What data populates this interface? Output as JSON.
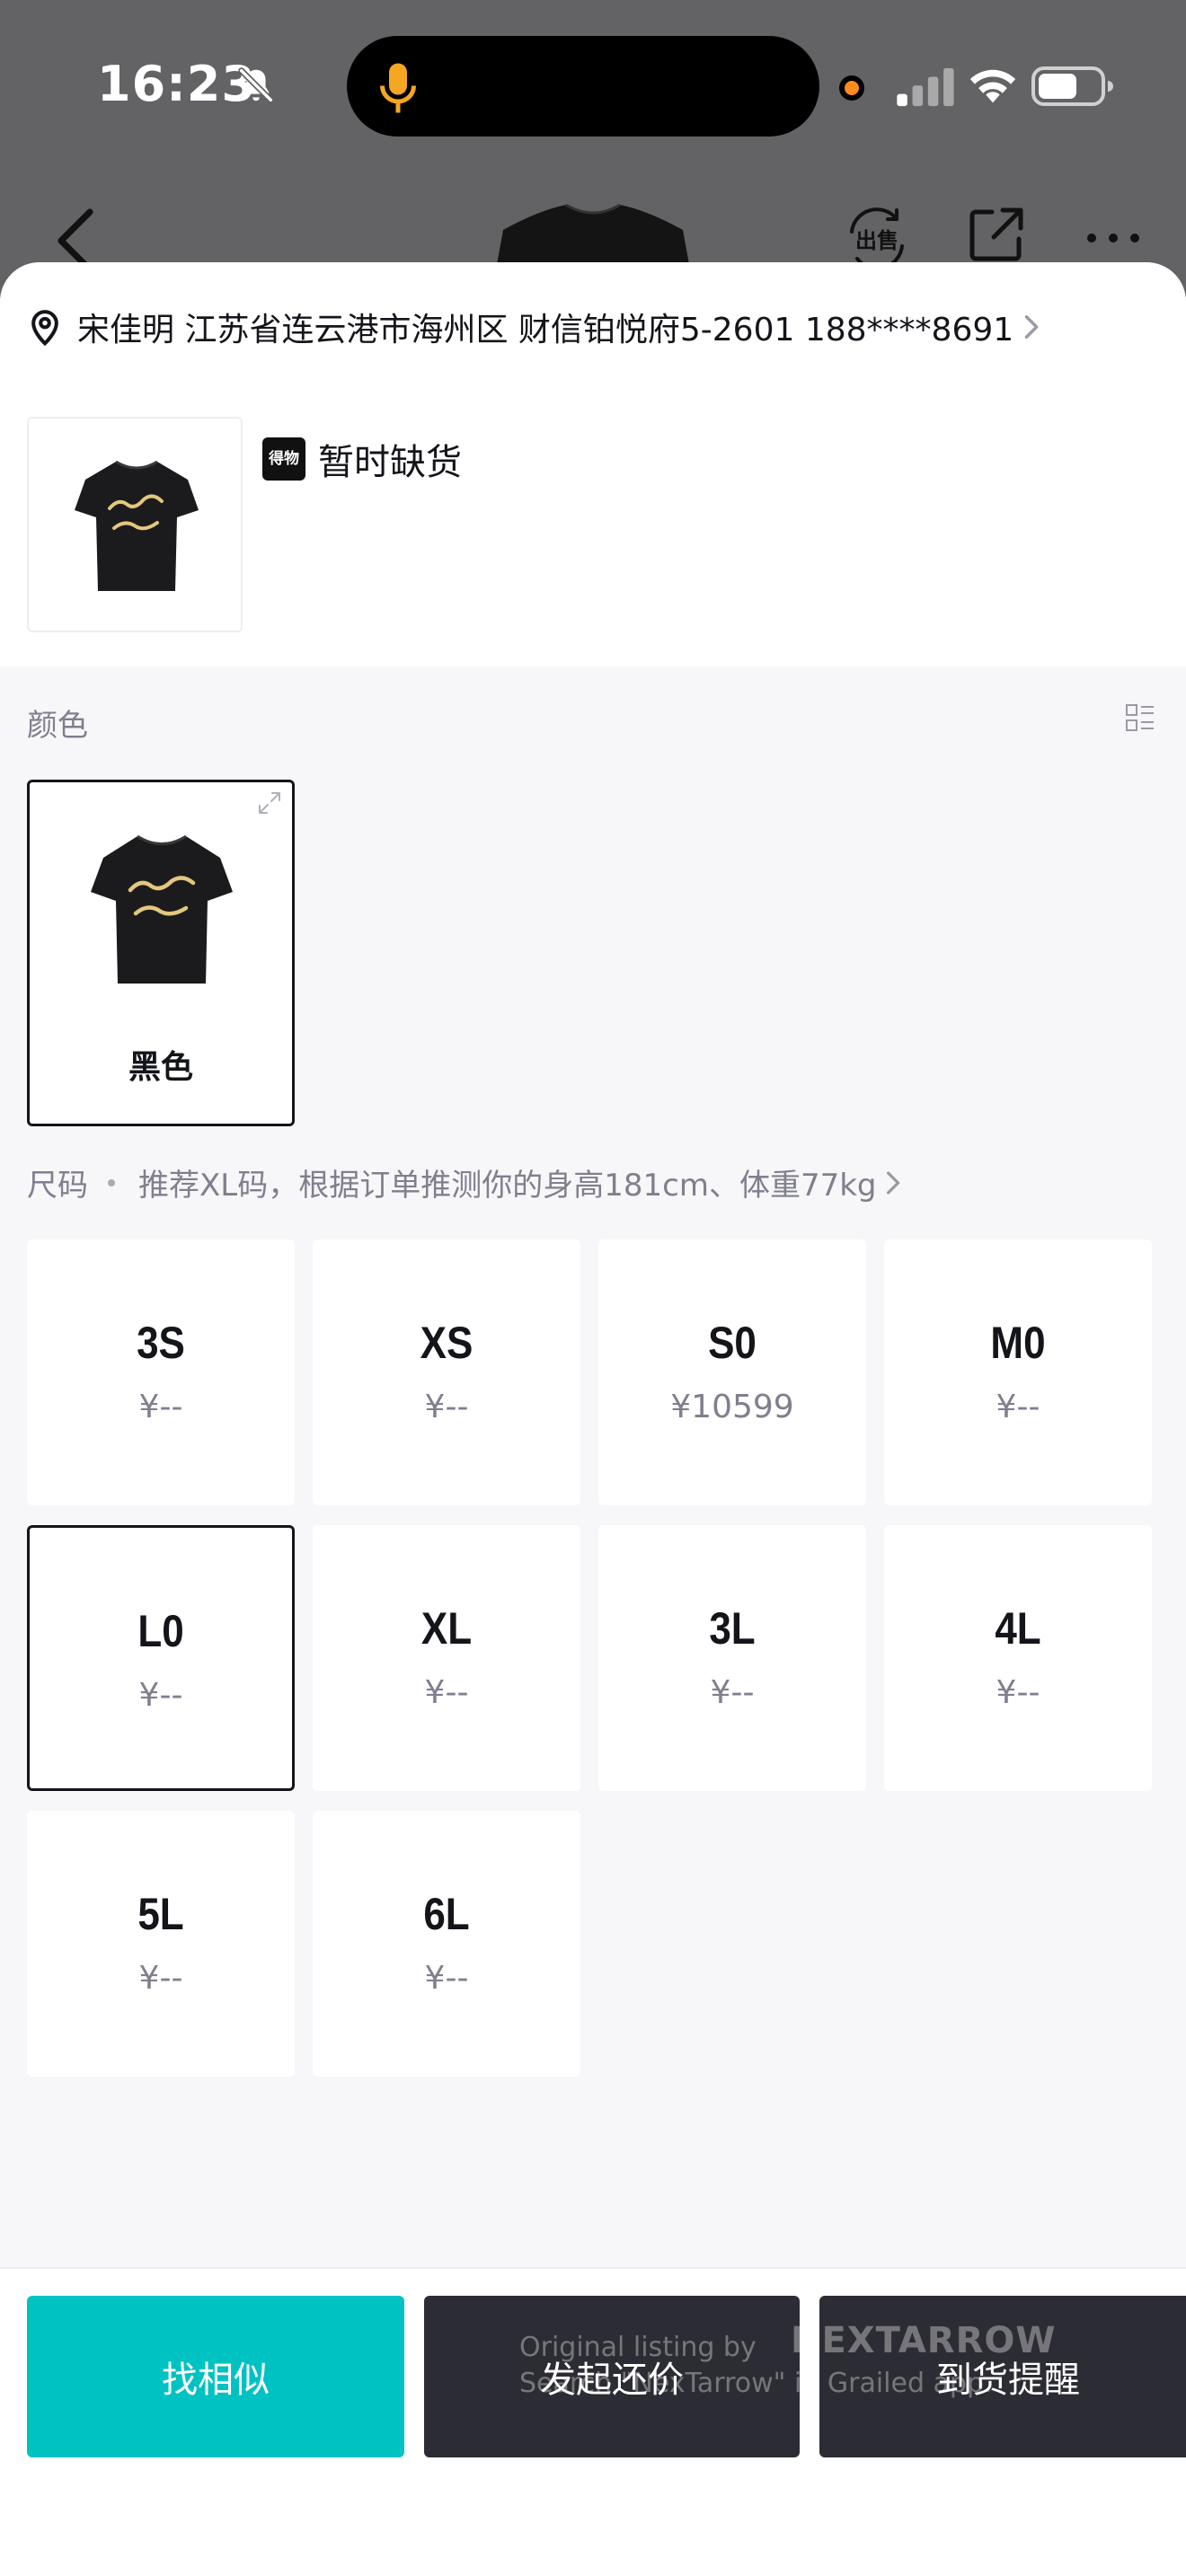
{
  "status_bar": {
    "time": "16:23",
    "icons": [
      "bell-off-icon",
      "microphone-icon",
      "recording-dot-icon",
      "cellular-signal-icon",
      "wifi-icon",
      "battery-icon"
    ]
  },
  "background_nav": {
    "sell_label": "出售",
    "icons": [
      "back-icon",
      "sell-icon",
      "share-icon",
      "more-icon"
    ]
  },
  "address": {
    "text": "宋佳明 江苏省连云港市海州区 财信铂悦府5-2601 188****8691"
  },
  "product": {
    "badge": "得物",
    "status": "暂时缺货"
  },
  "colors": {
    "label": "颜色",
    "items": [
      {
        "name": "黑色",
        "selected": true
      }
    ]
  },
  "sizes": {
    "label": "尺码",
    "hint": "推荐XL码，根据订单推测你的身高181cm、体重77kg",
    "items": [
      {
        "name": "3S",
        "price": "¥--",
        "selected": false
      },
      {
        "name": "XS",
        "price": "¥--",
        "selected": false
      },
      {
        "name": "S0",
        "price": "¥10599",
        "selected": false
      },
      {
        "name": "M0",
        "price": "¥--",
        "selected": false
      },
      {
        "name": "L0",
        "price": "¥--",
        "selected": true
      },
      {
        "name": "XL",
        "price": "¥--",
        "selected": false
      },
      {
        "name": "3L",
        "price": "¥--",
        "selected": false
      },
      {
        "name": "4L",
        "price": "¥--",
        "selected": false
      },
      {
        "name": "5L",
        "price": "¥--",
        "selected": false
      },
      {
        "name": "6L",
        "price": "¥--",
        "selected": false
      }
    ]
  },
  "actions": {
    "find_similar": "找相似",
    "bargain": "发起还价",
    "notify": "到货提醒"
  },
  "watermark": {
    "line1": "Original listing by",
    "brand": "NEXTARROW",
    "line2": "Search \"NexTarrow\" in Grailed app."
  },
  "colors_palette": {
    "accent_teal": "#01c2c3",
    "dark_button": "#2c2c34",
    "text_primary": "#14151a",
    "text_secondary": "#7f7f8e",
    "print_gold": "#e2c77e"
  }
}
